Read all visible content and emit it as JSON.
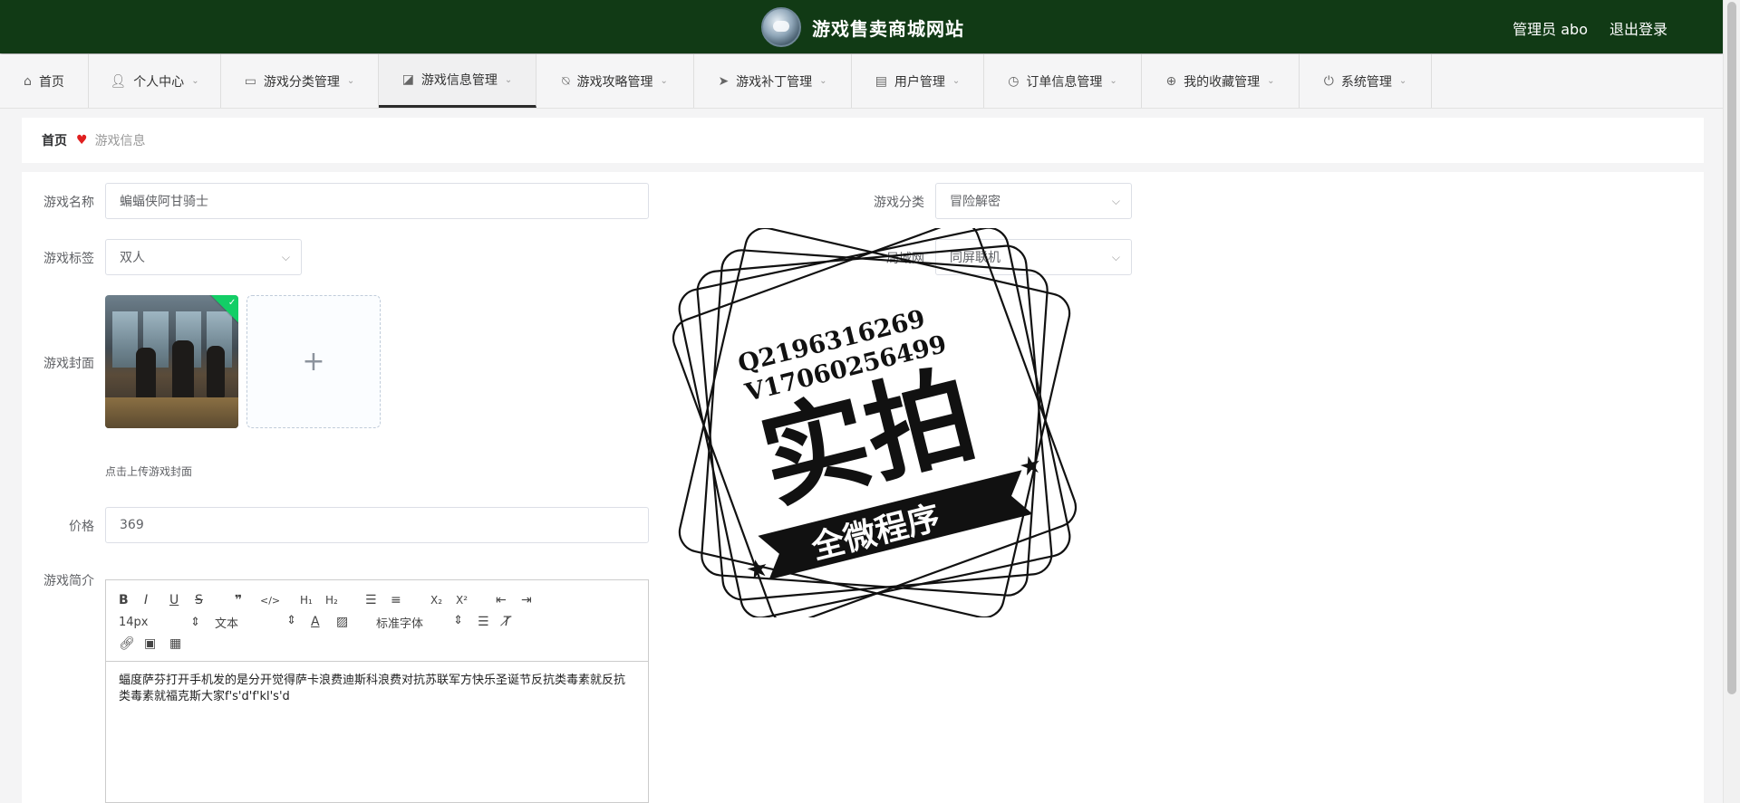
{
  "header": {
    "site_title": "游戏售卖商城网站",
    "admin_label": "管理员 abo",
    "logout_label": "退出登录"
  },
  "nav": {
    "items": [
      {
        "label": "首页",
        "icon": "home-icon",
        "active": false
      },
      {
        "label": "个人中心",
        "icon": "user-icon",
        "active": false
      },
      {
        "label": "游戏分类管理",
        "icon": "chat-icon",
        "active": false
      },
      {
        "label": "游戏信息管理",
        "icon": "chart-icon",
        "active": true
      },
      {
        "label": "游戏攻略管理",
        "icon": "bell-off-icon",
        "active": false
      },
      {
        "label": "游戏补丁管理",
        "icon": "send-icon",
        "active": false
      },
      {
        "label": "用户管理",
        "icon": "briefcase-icon",
        "active": false
      },
      {
        "label": "订单信息管理",
        "icon": "clock-icon",
        "active": false
      },
      {
        "label": "我的收藏管理",
        "icon": "target-icon",
        "active": false
      },
      {
        "label": "系统管理",
        "icon": "power-icon",
        "active": false
      }
    ]
  },
  "breadcrumb": {
    "home": "首页",
    "current": "游戏信息"
  },
  "form": {
    "name_label": "游戏名称",
    "name_value": "蝙蝠侠阿甘骑士",
    "category_label": "游戏分类",
    "category_value": "冒险解密",
    "tag_label": "游戏标签",
    "tag_value": "双人",
    "lan_label": "局域网",
    "lan_value": "同屏联机",
    "cover_label": "游戏封面",
    "cover_hint": "点击上传游戏封面",
    "price_label": "价格",
    "price_value": "369",
    "intro_label": "游戏简介",
    "editor": {
      "font_size": "14px",
      "paragraph": "文本",
      "font_family": "标准字体",
      "content": "蝠度萨芬打开手机发的是分开觉得萨卡浪费迪斯科浪费对抗苏联军方快乐圣诞节反抗类毒素就反抗类毒素就福克斯大家f's'd'f'kl's'd"
    }
  },
  "watermark": {
    "line1": "Q2196316269",
    "line2": "V17060256499",
    "main": "实拍",
    "banner": "全微程序"
  },
  "colors": {
    "header_bg": "#113a15",
    "success": "#13ce66",
    "heart": "#e02020"
  }
}
